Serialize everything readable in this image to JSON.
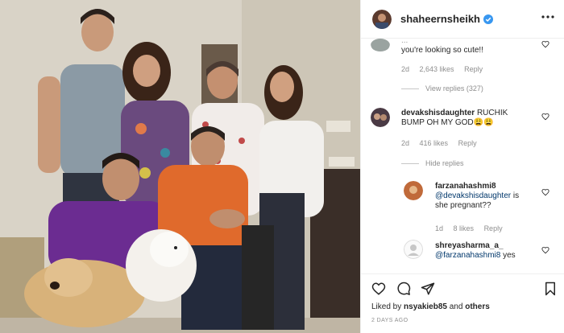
{
  "post": {
    "username": "shaheernsheikh",
    "verified": true,
    "photo_alt": "photo"
  },
  "comments": {
    "top_partial_faded": "...",
    "top_partial": "you're looking so cute!!",
    "top_meta": {
      "time": "2d",
      "likes": "2,643 likes",
      "reply": "Reply"
    },
    "view_replies": "View replies (327)",
    "c2": {
      "username": "devakshisdaughter",
      "text_line1": "RUCHIK",
      "text_line2": "BUMP OH MY GOD😩😩",
      "time": "2d",
      "likes": "416 likes",
      "reply": "Reply"
    },
    "hide_replies": "Hide replies",
    "r1": {
      "username": "farzanahashmi8",
      "mention": "@devakshisdaughter",
      "text_a": "is",
      "text_b": "she pregnant??",
      "time": "1d",
      "likes": "8 likes",
      "reply": "Reply"
    },
    "r2": {
      "username": "shreyasharma_a_",
      "mention": "@farzanahashmi8",
      "text": "yes"
    }
  },
  "actions": {
    "liked_by_prefix": "Liked by",
    "liked_by_user": "nsyakieb85",
    "liked_by_suffix": "and",
    "liked_by_others": "others",
    "time_ago": "2 DAYS AGO"
  },
  "colors": {
    "verified": "#3897f0",
    "orange_shirt": "#e06a2c",
    "purple_shirt": "#6b2c91",
    "grey_tshirt": "#8b9aa5",
    "dog": "#d8b27a"
  }
}
